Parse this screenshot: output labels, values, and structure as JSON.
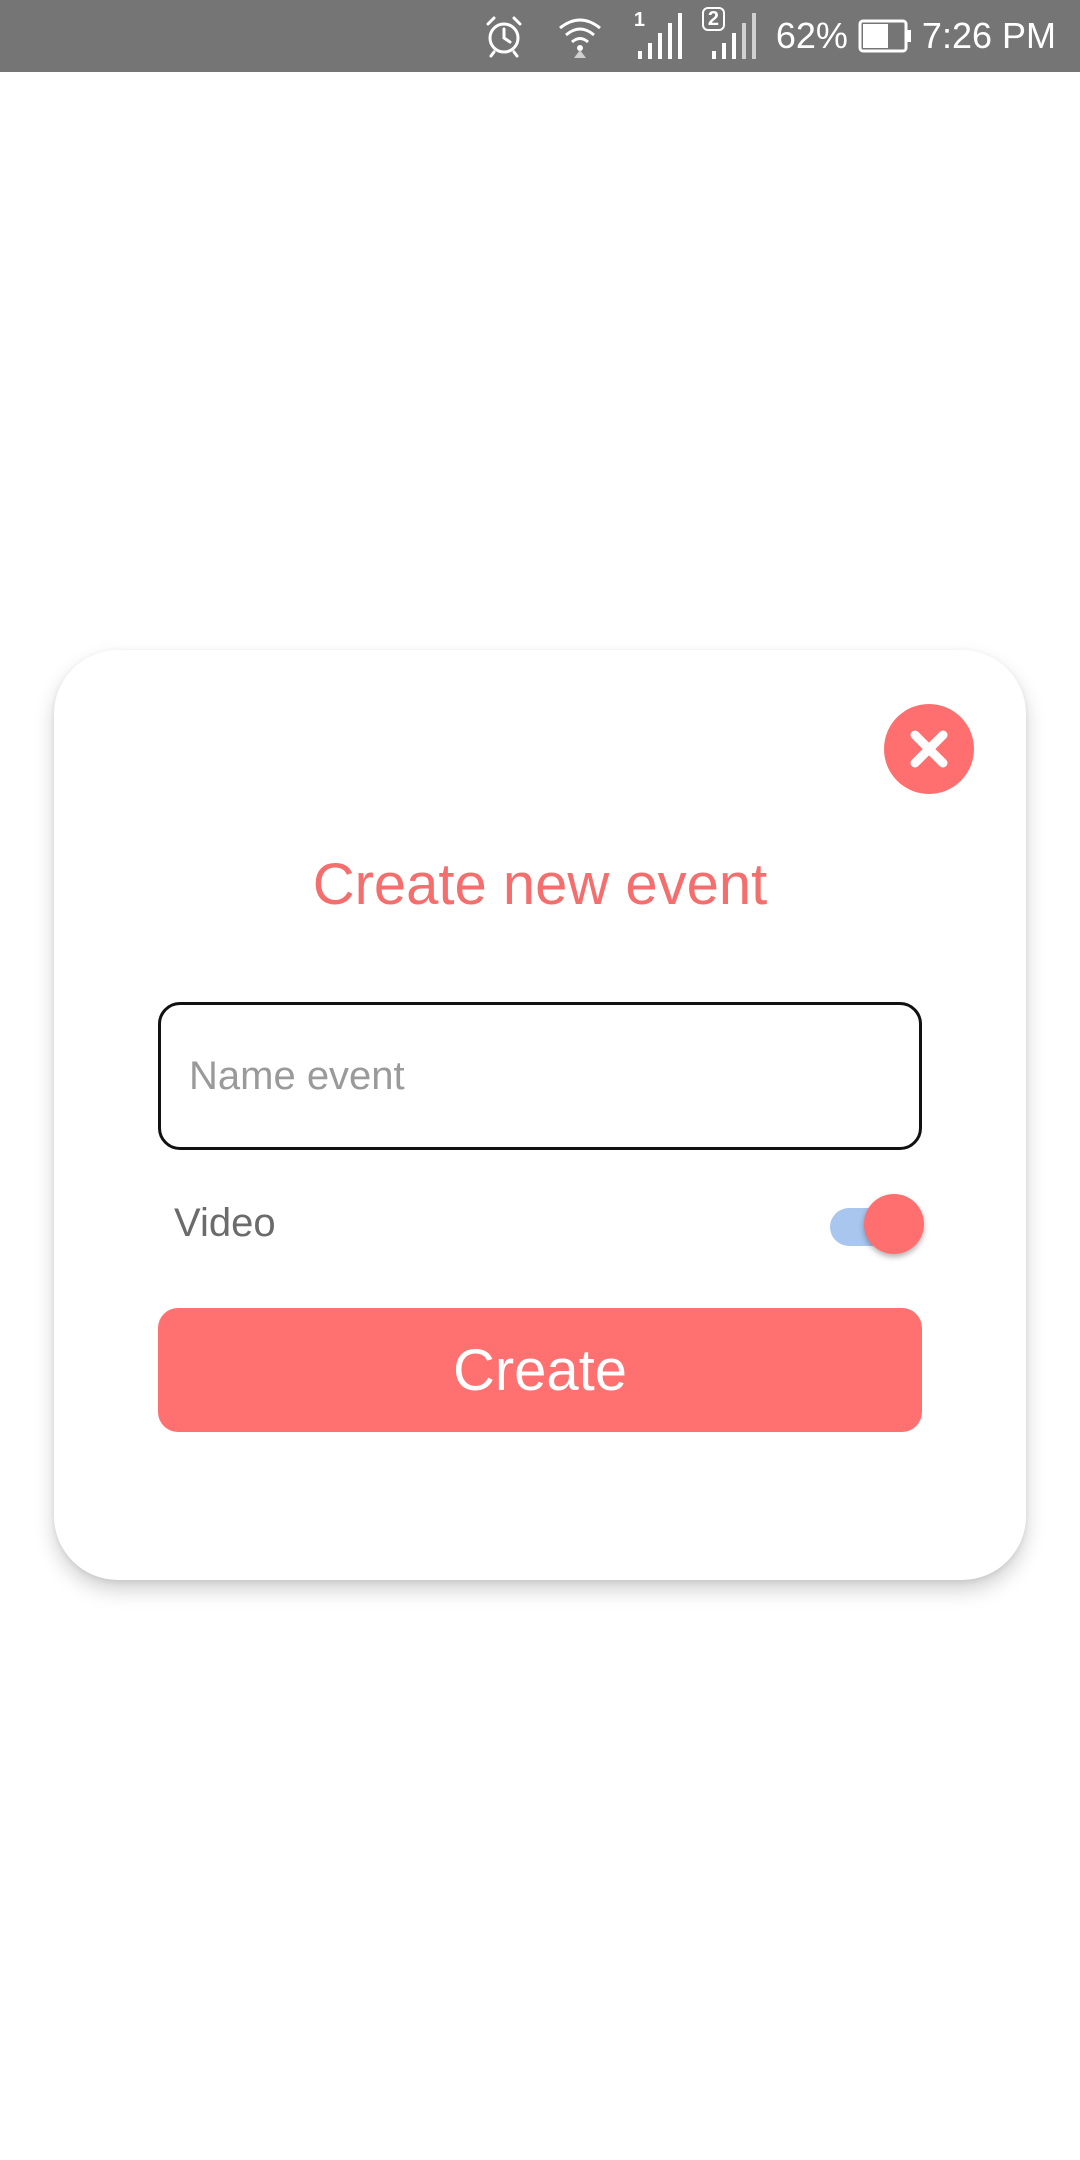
{
  "status_bar": {
    "alarm_icon": "alarm-clock-icon",
    "wifi_icon": "wifi-icon",
    "sim1_label": "1",
    "sim2_label": "2",
    "battery_percent": "62%",
    "battery_level": 0.62,
    "time": "7:26 PM",
    "background_color": "#757575"
  },
  "dialog": {
    "close_icon": "close-icon",
    "title": "Create new event",
    "name_input": {
      "placeholder": "Name event",
      "value": ""
    },
    "video_label": "Video",
    "video_toggle_on": true,
    "create_label": "Create"
  },
  "colors": {
    "accent": "#ff6f6f",
    "title_text": "#f56e6e",
    "toggle_track": "#a9c6ef",
    "label_text": "#6b6b6b",
    "placeholder_text": "#9a9a9a"
  }
}
